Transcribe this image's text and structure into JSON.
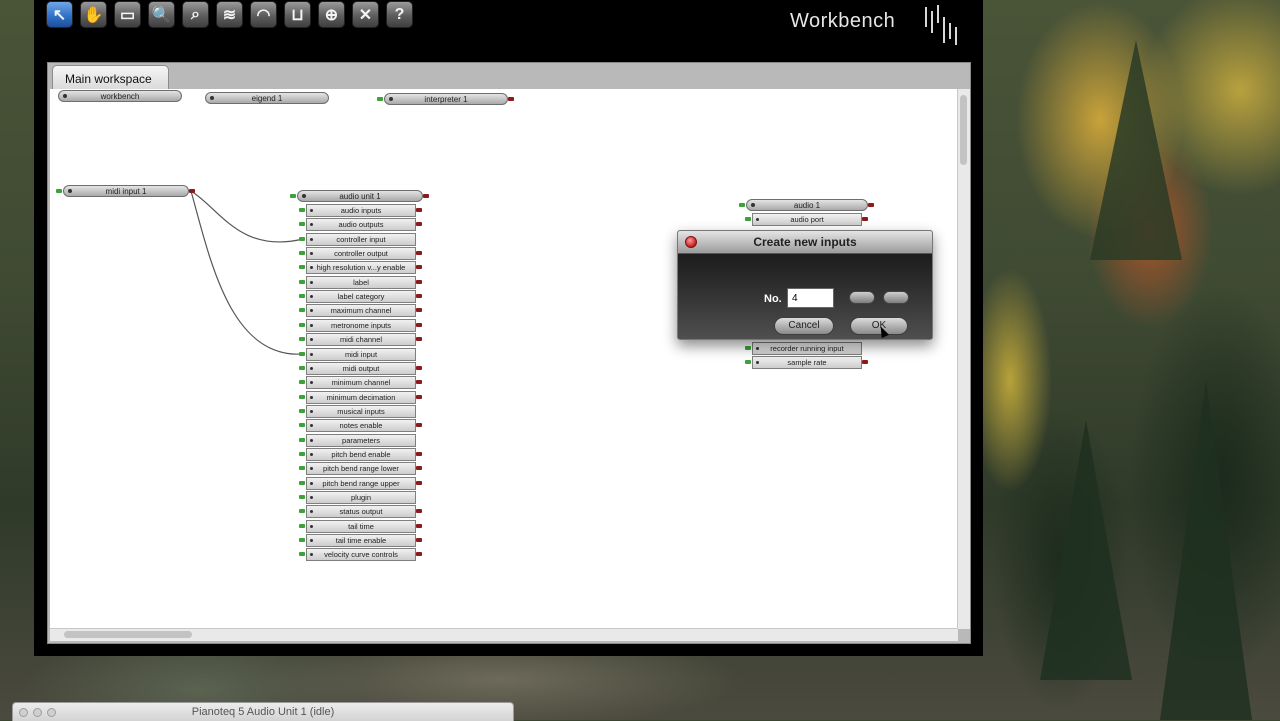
{
  "app": {
    "title": "Workbench",
    "toolbar": [
      {
        "name": "select-tool",
        "icon": "pointer-arrow-icon",
        "glyph": "↖",
        "active": true
      },
      {
        "name": "hand-tool",
        "icon": "hand-icon",
        "glyph": "✋"
      },
      {
        "name": "rectangle-tool",
        "icon": "rectangle-icon",
        "glyph": "▭"
      },
      {
        "name": "zoom-tool",
        "icon": "magnifier-icon",
        "glyph": "🔍"
      },
      {
        "name": "zoom-fit-tool",
        "icon": "zoom-document-icon",
        "glyph": "⌕"
      },
      {
        "name": "wiring-tool",
        "icon": "wires-icon",
        "glyph": "≋"
      },
      {
        "name": "tempo-tool",
        "icon": "gauge-icon",
        "glyph": "◠"
      },
      {
        "name": "routing-tool",
        "icon": "loop-icon",
        "glyph": "⊔"
      },
      {
        "name": "add-agent-tool",
        "icon": "add-agent-icon",
        "glyph": "⊕"
      },
      {
        "name": "delete-tool",
        "icon": "delete-x-icon",
        "glyph": "✕"
      },
      {
        "name": "help-tool",
        "icon": "question-icon",
        "glyph": "?"
      }
    ]
  },
  "workspace": {
    "tab": "Main workspace",
    "top_agents": [
      "workbench",
      "eigend 1",
      "interpreter 1"
    ],
    "midi_input": "midi input 1",
    "audio_unit": {
      "title": "audio unit 1",
      "ports": [
        "audio inputs",
        "audio outputs",
        "controller input",
        "controller output",
        "high resolution v...y enable",
        "label",
        "label category",
        "maximum channel",
        "metronome inputs",
        "midi channel",
        "midi input",
        "midi output",
        "minimum channel",
        "minimum decimation",
        "musical inputs",
        "notes enable",
        "parameters",
        "pitch bend enable",
        "pitch bend range lower",
        "pitch bend range upper",
        "plugin",
        "status output",
        "tail time",
        "tail time enable",
        "velocity curve controls"
      ]
    },
    "audio_agent": {
      "title": "audio 1",
      "ports_top": [
        "audio port"
      ],
      "ports_bottom": [
        "recorder running input",
        "sample rate"
      ]
    }
  },
  "dialog": {
    "title": "Create new inputs",
    "no_label": "No.",
    "no_value": "4",
    "cancel": "Cancel",
    "ok": "OK"
  },
  "bottom_window": {
    "title": "Pianoteq 5 Audio Unit 1 (idle)"
  }
}
